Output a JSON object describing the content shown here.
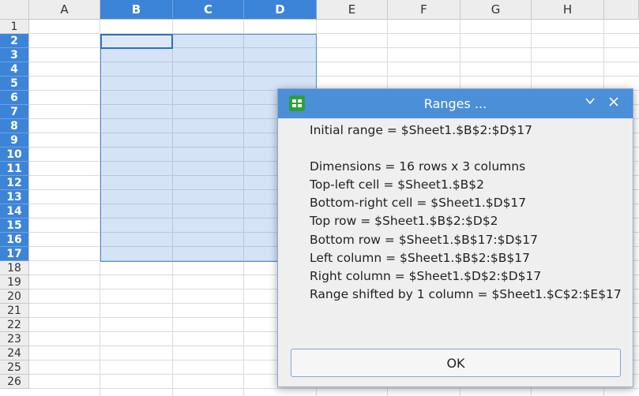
{
  "spreadsheet": {
    "columns": [
      "A",
      "B",
      "C",
      "D",
      "E",
      "F",
      "G",
      "H"
    ],
    "rows": [
      "1",
      "2",
      "3",
      "4",
      "5",
      "6",
      "7",
      "8",
      "9",
      "10",
      "11",
      "12",
      "13",
      "14",
      "15",
      "16",
      "17",
      "18",
      "19",
      "20",
      "21",
      "22",
      "23",
      "24",
      "25",
      "26"
    ],
    "selected_columns": [
      "B",
      "C",
      "D"
    ],
    "selected_rows_from": "2",
    "selected_rows_to": "17"
  },
  "dialog": {
    "title": "Ranges ...",
    "lines": [
      "Initial range = $Sheet1.$B$2:$D$17",
      "",
      "Dimensions = 16 rows x 3 columns",
      "Top-left cell = $Sheet1.$B$2",
      "Bottom-right cell = $Sheet1.$D$17",
      "Top row = $Sheet1.$B$2:$D$2",
      "Bottom row = $Sheet1.$B$17:$D$17",
      "Left column = $Sheet1.$B$2:$B$17",
      "Right column = $Sheet1.$D$2:$D$17",
      "Range shifted by 1 column = $Sheet1.$C$2:$E$17"
    ],
    "ok_label": "OK",
    "minimize_icon": "chevron-down-icon",
    "close_icon": "close-icon"
  }
}
